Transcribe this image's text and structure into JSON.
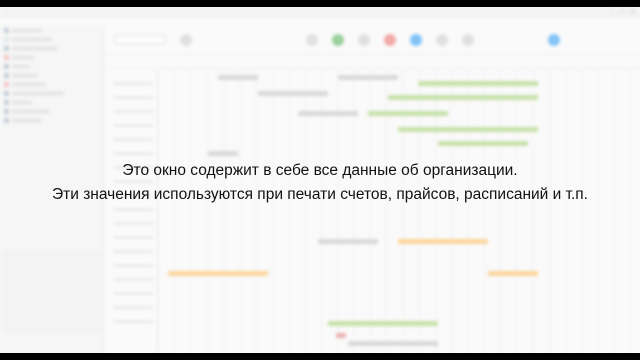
{
  "video_caption": {
    "line1": "Это окно содержит в себе все данные об организации.",
    "line2": "Эти значения используются при печати счетов, прайсов, расписаний и т.п."
  },
  "colors": {
    "caption_text": "#111111",
    "event_green": "#9ccc65",
    "event_orange": "#ffb74d",
    "event_gray": "#bdbdbd",
    "event_red": "#e57373"
  }
}
